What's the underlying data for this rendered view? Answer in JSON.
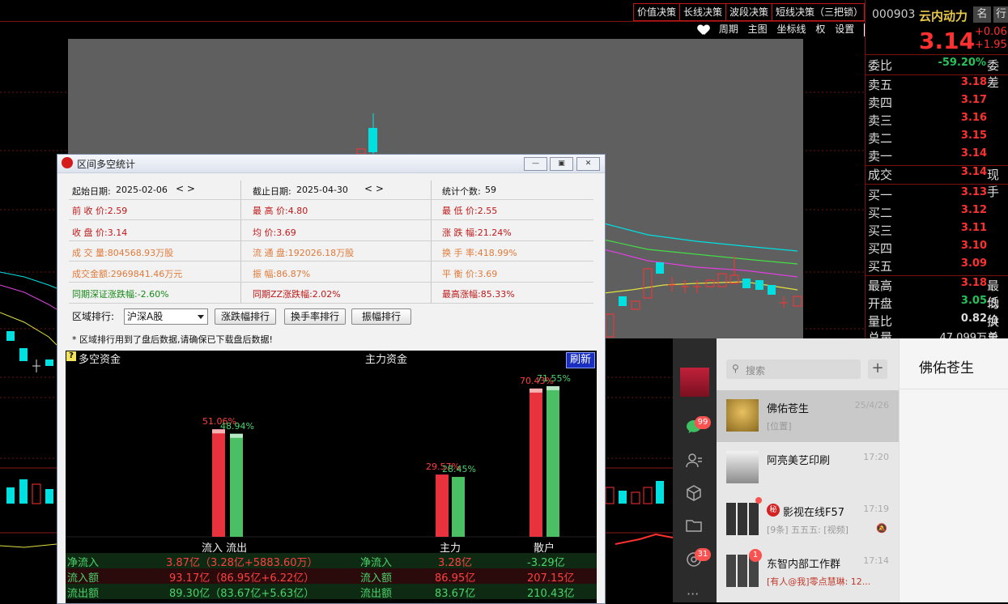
{
  "strategy_buttons": [
    "价值决策",
    "长线决策",
    "波段决策",
    "短线决策（三把锁）"
  ],
  "toolbar": {
    "items": [
      "周期",
      "主图",
      "坐标线",
      "权",
      "设置"
    ]
  },
  "quote": {
    "code": "000903",
    "name": "云内动力",
    "tags": [
      "名",
      "行"
    ],
    "price": "3.14",
    "change": "+0.06",
    "change_pct": "+1.95",
    "webi_label": "委比",
    "webi_value": "-59.20%",
    "webi_extra": "委差",
    "sell": [
      {
        "label": "卖五",
        "price": "3.18"
      },
      {
        "label": "卖四",
        "price": "3.17"
      },
      {
        "label": "卖三",
        "price": "3.16"
      },
      {
        "label": "卖二",
        "price": "3.15"
      },
      {
        "label": "卖一",
        "price": "3.14"
      }
    ],
    "deal_label": "成交",
    "deal_value": "3.14",
    "deal_extra": "现手",
    "buy": [
      {
        "label": "买一",
        "price": "3.13"
      },
      {
        "label": "买二",
        "price": "3.12"
      },
      {
        "label": "买三",
        "price": "3.11"
      },
      {
        "label": "买四",
        "price": "3.10"
      },
      {
        "label": "买五",
        "price": "3.09"
      }
    ],
    "stats": [
      {
        "label": "最高",
        "value": "3.18",
        "extra": "最低"
      },
      {
        "label": "开盘",
        "value": "3.05",
        "extra": "均价"
      },
      {
        "label": "量比",
        "value": "0.82",
        "extra": "换手"
      },
      {
        "label": "总量",
        "value": "47,099万",
        "extra": "总额"
      }
    ]
  },
  "dialog": {
    "title": "区间多空统计",
    "start_label": "起始日期:",
    "start_date": "2025-02-06",
    "end_label": "截止日期:",
    "end_date": "2025-04-30",
    "count_label": "统计个数:",
    "count": "59",
    "rows": [
      [
        "前 收 价:2.59",
        "最 高 价:4.80",
        "最 低 价:2.55"
      ],
      [
        "收 盘 价:3.14",
        "均    价:3.69",
        "涨 跌 幅:21.24%"
      ],
      [
        "成 交 量:804568.93万股",
        "流 通 盘:192026.18万股",
        "换 手 率:418.99%"
      ],
      [
        "成交金额:2969841.46万元",
        "振    幅:86.87%",
        "平 衡 价:3.69"
      ],
      [
        "同期深证涨跌幅:-2.60%",
        "同期ZZ涨跌幅:2.02%",
        "最高涨幅:85.33%"
      ]
    ],
    "rank_label": "区域排行:",
    "rank_select": "沪深A股",
    "rank_buttons": [
      "涨跌幅排行",
      "换手率排行",
      "振幅排行"
    ],
    "note": "* 区域排行用到了盘后数据,请确保已下载盘后数据!"
  },
  "flow": {
    "left_title": "多空资金",
    "center_title": "主力资金",
    "refresh": "刷新",
    "bars": {
      "inflow_pct": 51.06,
      "inflow_label": "51.06%",
      "outflow_pct": 48.94,
      "outflow_label": "48.94%",
      "main_in_pct": 29.57,
      "main_in_label": "29.57%",
      "main_out_pct": 28.45,
      "main_out_label": "28.45%",
      "retail_in_pct": 70.43,
      "retail_in_label": "70.43%",
      "retail_out_pct": 71.55,
      "retail_out_label": "71.55%"
    },
    "x_labels": {
      "inout": "流入 流出",
      "main": "主力",
      "retail": "散户"
    },
    "table": [
      {
        "label": "净流入",
        "value": "3.87亿（3.28亿+5883.60万）",
        "label2": "净流入",
        "main": "3.28亿",
        "retail": "-3.29亿"
      },
      {
        "label": "流入额",
        "value": "93.17亿（86.95亿+6.22亿）",
        "label2": "流入额",
        "main": "86.95亿",
        "retail": "207.15亿"
      },
      {
        "label": "流出额",
        "value": "89.30亿（83.67亿+5.63亿）",
        "label2": "流出额",
        "main": "83.67亿",
        "retail": "210.43亿"
      }
    ]
  },
  "wechat": {
    "search_placeholder": "搜索",
    "chat_title": "佛佑苍生",
    "side_badges": {
      "messages": "99",
      "moments": "31"
    },
    "chats": [
      {
        "name": "佛佑苍生",
        "time": "25/4/26",
        "preview": "[位置]"
      },
      {
        "name": "阿亮美艺印刷",
        "time": "17:20",
        "preview": ""
      },
      {
        "name": "影视在线F57",
        "time": "17:19",
        "preview": "[9条] 五五五: [视频]"
      },
      {
        "name": "东智内部工作群",
        "time": "17:14",
        "preview": "[有人@我]零点慧琳: 12..."
      }
    ],
    "chat3_tag": "秘",
    "chat4_badge": "1"
  },
  "colors": {
    "up": "#ff3030",
    "down": "#00e0e0",
    "green": "#25c25a",
    "red_bar": "#e8333f",
    "green_bar": "#4bbf63"
  }
}
